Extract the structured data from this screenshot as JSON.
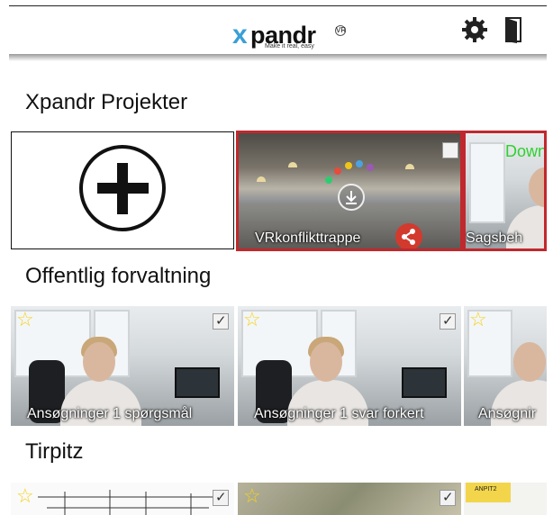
{
  "header": {
    "logo_x": "x",
    "logo_text": "pandr",
    "logo_reg": "VR",
    "logo_tagline": "Make it real, easy",
    "icons": [
      "gear-icon",
      "door-exit-icon"
    ]
  },
  "sections": {
    "projects": {
      "title": "Xpandr Projekter",
      "tiles": [
        {
          "label": "VRkonflikttrappe",
          "checked": false
        },
        {
          "label": "Sagsbeh",
          "overlay": "Down"
        }
      ]
    },
    "offentlig": {
      "title": "Offentlig forvaltning",
      "tiles": [
        {
          "label": "Ansøgninger 1 spørgsmål",
          "checked": true,
          "starred": true
        },
        {
          "label": "Ansøgninger 1 svar forkert",
          "checked": true,
          "starred": true
        },
        {
          "label": "Ansøgnir",
          "checked": false,
          "starred": true
        }
      ]
    },
    "tirpitz": {
      "title": "Tirpitz",
      "tiles": [
        {
          "checked": true,
          "starred": true
        },
        {
          "checked": true,
          "starred": true
        },
        {
          "note": "ANPIT2"
        }
      ]
    }
  },
  "colors": {
    "accent_red": "#c0282d",
    "logo_blue": "#3a9fd6",
    "star_yellow": "#f4d21d",
    "download_green": "#2fd12f"
  }
}
